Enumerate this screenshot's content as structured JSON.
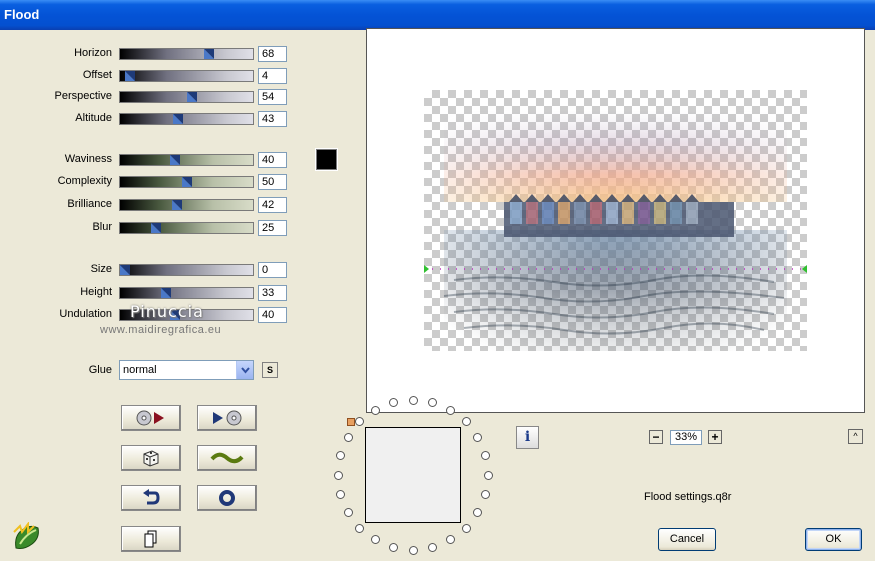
{
  "window": {
    "title": "Flood"
  },
  "sliders": [
    {
      "key": "horizon",
      "label": "Horizon",
      "value": "68",
      "fraction": 0.68,
      "style": "gray"
    },
    {
      "key": "offset",
      "label": "Offset",
      "value": "4",
      "fraction": 0.04,
      "style": "gray"
    },
    {
      "key": "perspective",
      "label": "Perspective",
      "value": "54",
      "fraction": 0.54,
      "style": "gray"
    },
    {
      "key": "altitude",
      "label": "Altitude",
      "value": "43",
      "fraction": 0.43,
      "style": "gray"
    },
    {
      "key": "waviness",
      "label": "Waviness",
      "value": "40",
      "fraction": 0.4,
      "style": "green"
    },
    {
      "key": "complexity",
      "label": "Complexity",
      "value": "50",
      "fraction": 0.5,
      "style": "green"
    },
    {
      "key": "brilliance",
      "label": "Brilliance",
      "value": "42",
      "fraction": 0.42,
      "style": "green"
    },
    {
      "key": "blur",
      "label": "Blur",
      "value": "25",
      "fraction": 0.25,
      "style": "green"
    },
    {
      "key": "size",
      "label": "Size",
      "value": "0",
      "fraction": 0.0,
      "style": "gray"
    },
    {
      "key": "height",
      "label": "Height",
      "value": "33",
      "fraction": 0.33,
      "style": "gray"
    },
    {
      "key": "undulation",
      "label": "Undulation",
      "value": "40",
      "fraction": 0.4,
      "style": "gray"
    }
  ],
  "color_swatch": {
    "color": "#000000"
  },
  "watermark": {
    "name": "Pinuccia",
    "site": "www.maidiregrafica.eu"
  },
  "glue": {
    "label": "Glue",
    "value": "normal",
    "s_button": "S"
  },
  "tool_buttons": [
    {
      "name": "load-preset-button",
      "icon": "disc-arrow-icon"
    },
    {
      "name": "save-preset-button",
      "icon": "arrow-disc-icon"
    },
    {
      "name": "randomize-button",
      "icon": "dice-icon"
    },
    {
      "name": "wave-preset-button",
      "icon": "wave-icon"
    },
    {
      "name": "undo-button",
      "icon": "undo-arrow-icon"
    },
    {
      "name": "reset-button",
      "icon": "ring-icon"
    },
    {
      "name": "copy-button",
      "icon": "copy-pages-icon"
    }
  ],
  "zoom": {
    "minus": "−",
    "value": "33%",
    "plus": "+"
  },
  "info": {
    "label": "i"
  },
  "caret": {
    "label": "^"
  },
  "settings_file": "Flood settings.q8r",
  "buttons": {
    "cancel": "Cancel",
    "ok": "OK"
  }
}
